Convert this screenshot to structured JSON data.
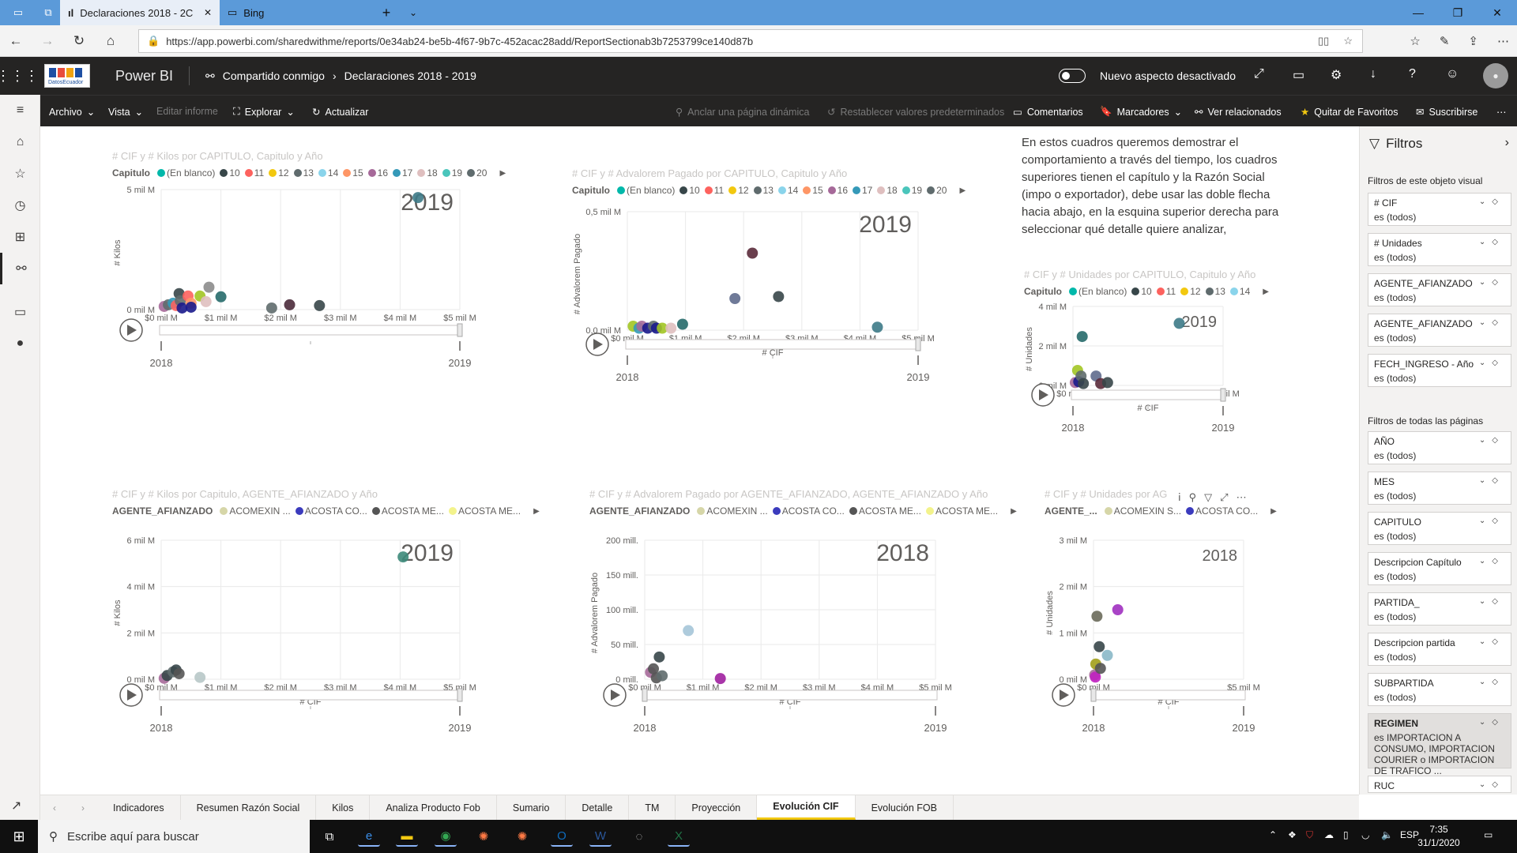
{
  "browser": {
    "tabs": [
      {
        "label": "Declaraciones 2018 - 2C"
      },
      {
        "label": "Bing"
      }
    ],
    "url": "https://app.powerbi.com/sharedwithme/reports/0e34ab24-be5b-4f67-9b7c-452acac28add/ReportSectionab3b7253799ce140d87b"
  },
  "header": {
    "logo_text": "DatosEcuador",
    "app_name": "Power BI",
    "breadcrumb": [
      "Compartido conmigo",
      "Declaraciones 2018 - 2019"
    ],
    "toggle_label": "Nuevo aspecto desactivado"
  },
  "commandbar": {
    "archivo": "Archivo",
    "vista": "Vista",
    "editar": "Editar informe",
    "explorar": "Explorar",
    "actualizar": "Actualizar",
    "anclar": "Anclar una página dinámica",
    "restablecer": "Restablecer valores predeterminados",
    "comentarios": "Comentarios",
    "marcadores": "Marcadores",
    "relacionados": "Ver relacionados",
    "favoritos": "Quitar de Favoritos",
    "suscribirse": "Suscribirse"
  },
  "textbox": "En estos cuadros queremos demostrar el comportamiento a través del tiempo, los cuadros superiores tienen el capítulo y la Razón Social (impo o exportador), debe usar las doble flecha hacia abajo, en la esquina superior derecha para seleccionar qué detalle quiere analizar, recomendamos el uso del enfoque (la",
  "filters": {
    "title": "Filtros",
    "visual_section": "Filtros de este objeto visual",
    "visual_filters": [
      {
        "name": "# CIF",
        "value": "es (todos)"
      },
      {
        "name": "# Unidades",
        "value": "es (todos)"
      },
      {
        "name": "AGENTE_AFIANZADO",
        "value": "es (todos)"
      },
      {
        "name": "AGENTE_AFIANZADO",
        "value": "es (todos)"
      },
      {
        "name": "FECH_INGRESO - Año",
        "value": "es (todos)"
      }
    ],
    "page_section": "Filtros de todas las páginas",
    "page_filters": [
      {
        "name": "AÑO",
        "value": "es (todos)"
      },
      {
        "name": "MES",
        "value": "es (todos)"
      },
      {
        "name": "CAPITULO",
        "value": "es (todos)"
      },
      {
        "name": "Descripcion Capítulo",
        "value": "es (todos)"
      },
      {
        "name": "PARTIDA_",
        "value": "es (todos)"
      },
      {
        "name": "Descripcion partida",
        "value": "es (todos)"
      },
      {
        "name": "SUBPARTIDA",
        "value": "es (todos)"
      },
      {
        "name": "REGIMEN",
        "value": "es IMPORTACION A CONSUMO, IMPORTACION COURIER o IMPORTACION DE TRAFICO ..."
      },
      {
        "name": "RUC",
        "value": ""
      }
    ]
  },
  "page_tabs": [
    "Indicadores",
    "Resumen Razón Social",
    "Kilos",
    "Analiza Producto Fob",
    "Sumario",
    "Detalle",
    "TM",
    "Proyección",
    "Evolución CIF",
    "Evolución FOB"
  ],
  "active_tab": "Evolución CIF",
  "taskbar": {
    "search_placeholder": "Escribe aquí para buscar",
    "lang": "ESP",
    "time": "7:35",
    "date": "31/1/2020"
  },
  "visuals": [
    {
      "title": "# CIF y # Kilos por CAPITULO, Capitulo y Año",
      "legend_title": "Capitulo",
      "legend": [
        "(En blanco)",
        "10",
        "11",
        "12",
        "13",
        "14",
        "15",
        "16",
        "17",
        "18",
        "19",
        "20"
      ],
      "legend_colors": [
        "#01b8aa",
        "#374649",
        "#fd625e",
        "#f2c80f",
        "#5f6b6d",
        "#8ad4eb",
        "#fe9666",
        "#a66999",
        "#3599b8",
        "#dfbfbf",
        "#4ac5bb",
        "#5f6b6d"
      ],
      "ylabel": "# Kilos",
      "xlabel": "# CIF",
      "yticks": [
        "0 mil M",
        "5 mil M"
      ],
      "xticks": [
        "$0 mil M",
        "$1 mil M",
        "$2 mil M",
        "$3 mil M",
        "$4 mil M",
        "$5 mil M"
      ],
      "year_label": "2019",
      "play_start": "2018",
      "play_end": "2019"
    },
    {
      "title": "# CIF y # Advalorem Pagado por CAPITULO, Capitulo y Año",
      "legend_title": "Capitulo",
      "legend": [
        "(En blanco)",
        "10",
        "11",
        "12",
        "13",
        "14",
        "15",
        "16",
        "17",
        "18",
        "19",
        "20"
      ],
      "legend_colors": [
        "#01b8aa",
        "#374649",
        "#fd625e",
        "#f2c80f",
        "#5f6b6d",
        "#8ad4eb",
        "#fe9666",
        "#a66999",
        "#3599b8",
        "#dfbfbf",
        "#4ac5bb",
        "#5f6b6d"
      ],
      "ylabel": "# Advalorem Pagado",
      "xlabel": "# CIF",
      "yticks": [
        "0,0 mil M",
        "0,5 mil M"
      ],
      "xticks": [
        "$0 mil M",
        "$1 mil M",
        "$2 mil M",
        "$3 mil M",
        "$4 mil M",
        "$5 mil M"
      ],
      "year_label": "2019",
      "play_start": "2018",
      "play_end": "2019"
    },
    {
      "title": "# CIF y # Unidades por CAPITULO, Capitulo y Año",
      "legend_title": "Capitulo",
      "legend": [
        "(En blanco)",
        "10",
        "11",
        "12",
        "13",
        "14"
      ],
      "legend_colors": [
        "#01b8aa",
        "#374649",
        "#fd625e",
        "#f2c80f",
        "#5f6b6d",
        "#8ad4eb"
      ],
      "ylabel": "# Unidades",
      "xlabel": "# CIF",
      "yticks": [
        "0 mil M",
        "2 mil M",
        "4 mil M"
      ],
      "xticks": [
        "$0 mil M",
        "$5 mil M"
      ],
      "year_label": "2019",
      "play_start": "2018",
      "play_end": "2019"
    },
    {
      "title": "# CIF y # Kilos por Capitulo, AGENTE_AFIANZADO y Año",
      "legend_title": "AGENTE_AFIANZADO",
      "legend": [
        "ACOMEXIN ...",
        "ACOSTA CO...",
        "ACOSTA ME...",
        "ACOSTA ME..."
      ],
      "legend_colors": [
        "#d6d6a8",
        "#3b3bbd",
        "#555555",
        "#f3f38c"
      ],
      "ylabel": "# Kilos",
      "xlabel": "# CIF",
      "yticks": [
        "0 mil M",
        "2 mil M",
        "4 mil M",
        "6 mil M"
      ],
      "xticks": [
        "$0 mil M",
        "$1 mil M",
        "$2 mil M",
        "$3 mil M",
        "$4 mil M",
        "$5 mil M"
      ],
      "year_label": "2019",
      "play_start": "2018",
      "play_end": "2019"
    },
    {
      "title": "# CIF y # Advalorem Pagado por AGENTE_AFIANZADO, AGENTE_AFIANZADO y Año",
      "legend_title": "AGENTE_AFIANZADO",
      "legend": [
        "ACOMEXIN ...",
        "ACOSTA CO...",
        "ACOSTA ME...",
        "ACOSTA ME..."
      ],
      "legend_colors": [
        "#d6d6a8",
        "#3b3bbd",
        "#555555",
        "#f3f38c"
      ],
      "ylabel": "# Advalorem Pagado",
      "xlabel": "# CIF",
      "yticks": [
        "0 mill.",
        "50 mill.",
        "100 mill.",
        "150 mill.",
        "200 mill."
      ],
      "xticks": [
        "$0 mil M",
        "$1 mil M",
        "$2 mil M",
        "$3 mil M",
        "$4 mil M",
        "$5 mil M"
      ],
      "year_label": "2018",
      "play_start": "2018",
      "play_end": "2019"
    },
    {
      "title": "# CIF y # Unidades por AG",
      "legend_title": "AGENTE_...",
      "legend": [
        "ACOMEXIN S...",
        "ACOSTA CO..."
      ],
      "legend_colors": [
        "#d6d6a8",
        "#3b3bbd"
      ],
      "ylabel": "# Unidades",
      "xlabel": "# CIF",
      "yticks": [
        "0 mil M",
        "1 mil M",
        "2 mil M",
        "3 mil M"
      ],
      "xticks": [
        "$0 mil M",
        "$5 mil M"
      ],
      "year_label": "2018",
      "play_start": "2018",
      "play_end": "2019"
    }
  ],
  "chart_data": [
    {
      "type": "scatter",
      "title": "# CIF y # Kilos por CAPITULO, Capitulo y Año",
      "xlabel": "# CIF",
      "ylabel": "# Kilos",
      "xlim": [
        0,
        5
      ],
      "ylim": [
        0,
        7.5
      ],
      "points": [
        [
          0.05,
          0.2,
          "#a66999"
        ],
        [
          0.12,
          0.3,
          "#5f6b6d"
        ],
        [
          0.2,
          0.4,
          "#3599b8"
        ],
        [
          0.25,
          0.25,
          "#fd625e"
        ],
        [
          0.3,
          1.0,
          "#374649"
        ],
        [
          0.32,
          0.55,
          "#5f6b6d"
        ],
        [
          0.35,
          0.1,
          "#1a1a8c"
        ],
        [
          0.45,
          0.85,
          "#fd625e"
        ],
        [
          0.5,
          0.4,
          "#fe9666"
        ],
        [
          0.5,
          0.15,
          "#1a1a8c"
        ],
        [
          0.65,
          0.85,
          "#a2c523"
        ],
        [
          0.75,
          0.5,
          "#dfbfbf"
        ],
        [
          0.8,
          1.4,
          "#8c8c8c"
        ],
        [
          1.0,
          0.8,
          "#266a6a"
        ],
        [
          1.85,
          0.1,
          "#5f6b6d"
        ],
        [
          2.15,
          0.3,
          "#4a2a3a"
        ],
        [
          2.65,
          0.25,
          "#374649"
        ],
        [
          4.3,
          7.0,
          "#3d7a87"
        ]
      ]
    },
    {
      "type": "scatter",
      "title": "# CIF y # Advalorem Pagado por CAPITULO, Capitulo y Año",
      "xlabel": "# CIF",
      "ylabel": "# Advalorem Pagado",
      "xlim": [
        0,
        5
      ],
      "ylim": [
        0,
        0.6
      ],
      "points": [
        [
          0.1,
          0.02,
          "#a2c523"
        ],
        [
          0.2,
          0.01,
          "#3599b8"
        ],
        [
          0.25,
          0.02,
          "#a66999"
        ],
        [
          0.35,
          0.01,
          "#1a1a8c"
        ],
        [
          0.45,
          0.02,
          "#5f6b6d"
        ],
        [
          0.5,
          0.01,
          "#1a1a8c"
        ],
        [
          0.6,
          0.01,
          "#a2c523"
        ],
        [
          0.75,
          0.01,
          "#dfbfbf"
        ],
        [
          0.95,
          0.03,
          "#266a6a"
        ],
        [
          1.85,
          0.16,
          "#5f6b8d"
        ],
        [
          2.15,
          0.39,
          "#5a2a3a"
        ],
        [
          2.6,
          0.17,
          "#374649"
        ],
        [
          4.3,
          0.015,
          "#3d7a87"
        ]
      ]
    },
    {
      "type": "scatter",
      "title": "# CIF y # Unidades por CAPITULO, Capitulo y Año",
      "xlabel": "# CIF",
      "ylabel": "# Unidades",
      "xlim": [
        0,
        6.5
      ],
      "ylim": [
        0,
        4.2
      ],
      "points": [
        [
          0.1,
          0.15,
          "#a66999"
        ],
        [
          0.2,
          0.8,
          "#a2c523"
        ],
        [
          0.25,
          0.2,
          "#1a1a8c"
        ],
        [
          0.35,
          0.5,
          "#5f6b6d"
        ],
        [
          0.4,
          2.6,
          "#266a6a"
        ],
        [
          0.45,
          0.1,
          "#374649"
        ],
        [
          1.0,
          0.5,
          "#5f6b8d"
        ],
        [
          1.2,
          0.1,
          "#5a2a3a"
        ],
        [
          1.5,
          0.15,
          "#374649"
        ],
        [
          4.6,
          3.3,
          "#3d7a87"
        ]
      ]
    },
    {
      "type": "scatter",
      "title": "# CIF y # Kilos por Capitulo, AGENTE_AFIANZADO y Año",
      "xlabel": "# CIF",
      "ylabel": "# Kilos",
      "xlim": [
        0,
        5
      ],
      "ylim": [
        0,
        7.5
      ],
      "points": [
        [
          0.05,
          0.05,
          "#a66999"
        ],
        [
          0.1,
          0.2,
          "#374649"
        ],
        [
          0.2,
          0.4,
          "#5f6b6d"
        ],
        [
          0.25,
          0.5,
          "#374649"
        ],
        [
          0.3,
          0.3,
          "#555555"
        ],
        [
          0.65,
          0.1,
          "#b8c8c8"
        ],
        [
          4.05,
          6.6,
          "#3d8a7a"
        ]
      ]
    },
    {
      "type": "scatter",
      "title": "# CIF y # Advalorem Pagado por AGENTE_AFIANZADO, AGENTE_AFIANZADO y Año",
      "xlabel": "# CIF",
      "ylabel": "# Advalorem Pagado",
      "xlim": [
        0,
        5
      ],
      "ylim": [
        0,
        200
      ],
      "points": [
        [
          0.1,
          10,
          "#a66999"
        ],
        [
          0.15,
          15,
          "#555555"
        ],
        [
          0.2,
          2,
          "#555555"
        ],
        [
          0.25,
          32,
          "#374649"
        ],
        [
          0.3,
          5,
          "#5f6b6d"
        ],
        [
          0.75,
          70,
          "#a5c5d8"
        ],
        [
          1.3,
          1,
          "#a020a0"
        ]
      ]
    },
    {
      "type": "scatter",
      "title": "# CIF y # Unidades por AG",
      "xlabel": "# CIF",
      "ylabel": "# Unidades",
      "xlim": [
        0,
        6.5
      ],
      "ylim": [
        0,
        3.2
      ],
      "points": [
        [
          0.05,
          0.1,
          "#a66999"
        ],
        [
          0.08,
          0.05,
          "#c020c0"
        ],
        [
          0.1,
          0.35,
          "#a2a01a"
        ],
        [
          0.15,
          1.45,
          "#6a6a5a"
        ],
        [
          0.25,
          0.75,
          "#374649"
        ],
        [
          0.3,
          0.25,
          "#555555"
        ],
        [
          0.6,
          0.55,
          "#8ab8c8"
        ],
        [
          1.05,
          1.6,
          "#a030c0"
        ]
      ]
    }
  ]
}
